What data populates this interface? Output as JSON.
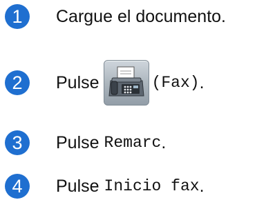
{
  "steps": [
    {
      "number": "1",
      "text": "Cargue el documento."
    },
    {
      "number": "2",
      "prefix": "Pulse",
      "button_label": "(Fax)",
      "suffix": "."
    },
    {
      "number": "3",
      "prefix": "Pulse",
      "code": "Remarc",
      "suffix": "."
    },
    {
      "number": "4",
      "prefix": "Pulse",
      "code": "Inicio fax",
      "suffix": "."
    }
  ],
  "icons": {
    "fax": "fax-machine-icon"
  },
  "colors": {
    "badge": "#1f6fd0",
    "text": "#111111"
  }
}
